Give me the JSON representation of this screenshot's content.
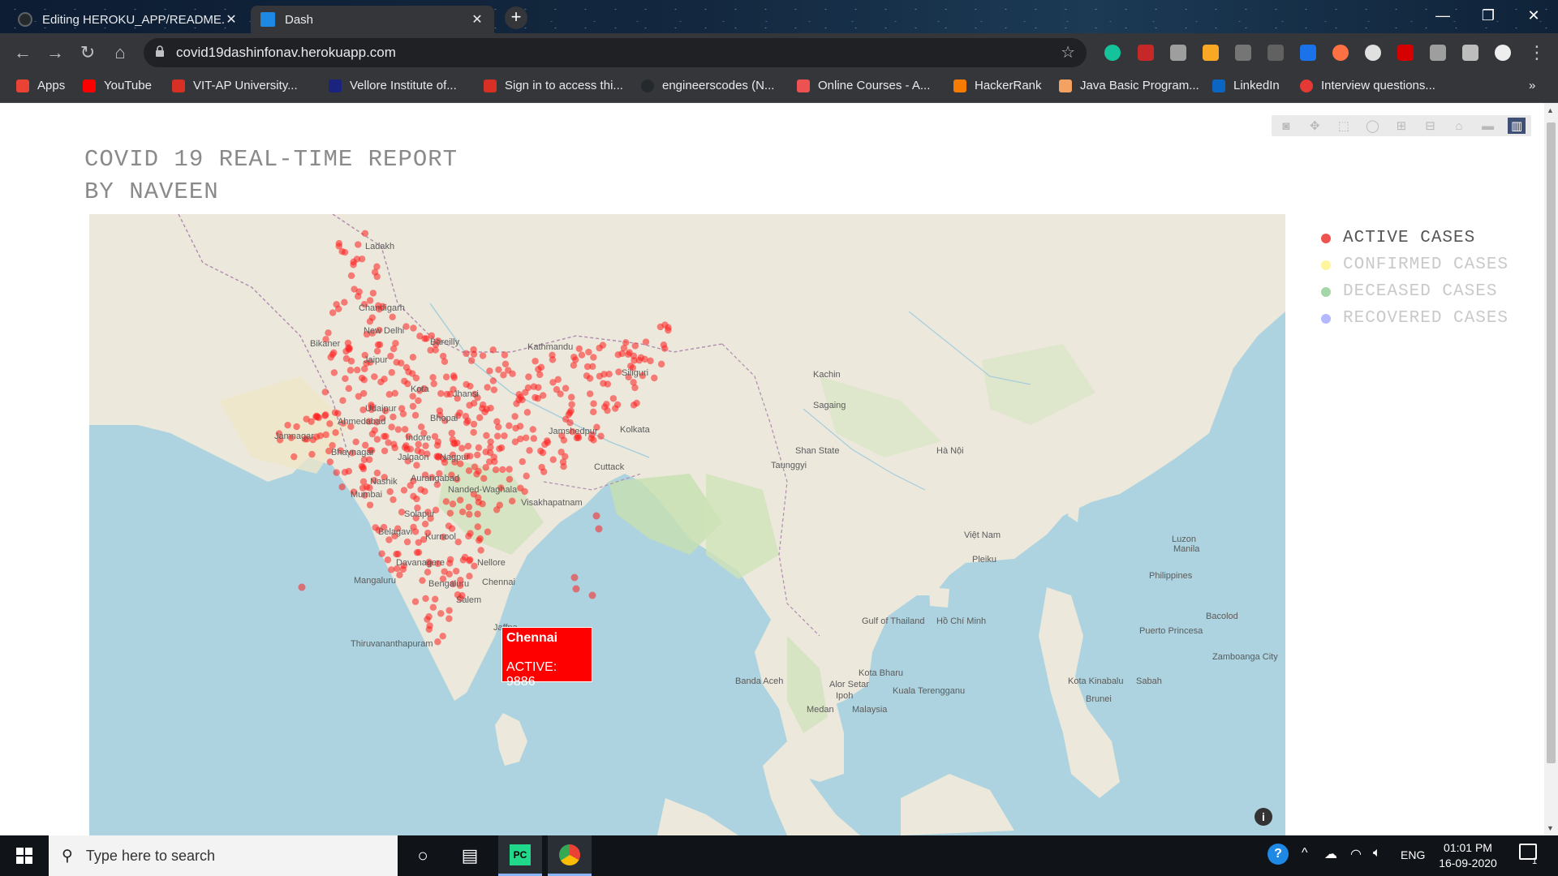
{
  "browser": {
    "tabs": [
      {
        "title": "Editing HEROKU_APP/README.m",
        "active": false
      },
      {
        "title": "Dash",
        "active": true
      }
    ],
    "url": "covid19dashinfonav.herokuapp.com",
    "bookmarks": [
      "Apps",
      "YouTube",
      "VIT-AP University...",
      "Vellore Institute of...",
      "Sign in to access thi...",
      "engineerscodes (N...",
      "Online Courses - A...",
      "HackerRank",
      "Java Basic Program...",
      "LinkedIn",
      "Interview questions..."
    ]
  },
  "page": {
    "title_line1": "COVID 19 REAL-TIME REPORT",
    "title_line2": "BY NAVEEN"
  },
  "legend": [
    {
      "label": "ACTIVE CASES",
      "color": "#ef5350"
    },
    {
      "label": "CONFIRMED CASES",
      "color": "#fff59d"
    },
    {
      "label": "DECEASED CASES",
      "color": "#a5d6a7"
    },
    {
      "label": "RECOVERED CASES",
      "color": "#b3b8ff"
    }
  ],
  "tooltip": {
    "city": "Chennai",
    "value": "ACTIVE: 9886"
  },
  "map_labels": [
    "Ladakh",
    "Chandigarh",
    "New Delhi",
    "Bareilly",
    "Kathmandu",
    "Jaipur",
    "Bikaner",
    "Kota",
    "Jhansi",
    "Bhopal",
    "Indore",
    "Ahmedabad",
    "Udaipur",
    "Jamnagar",
    "Bhavnagar",
    "Nagpur",
    "Jalgaon",
    "Nashik",
    "Mumbai",
    "Aurangabad",
    "Nanded-Waghala",
    "Solapur",
    "Belagavi",
    "Kurnool",
    "Davanagere",
    "Nellore",
    "Mangaluru",
    "Bengaluru",
    "Salem",
    "Thiruvananthapuram",
    "Jaffna",
    "Visakhapatnam",
    "Cuttack",
    "Kolkata",
    "Jamshedpur",
    "Siliguri",
    "Taunggyi",
    "Shan State",
    "Hà Nội",
    "Việt Nam",
    "Pleiku",
    "Hồ Chí Minh",
    "Philippines",
    "Luzon",
    "Manila",
    "Bacolod",
    "Puerto Princesa",
    "Zamboanga City",
    "Kota Bharu",
    "Alor Setar",
    "Ipoh",
    "Kuala Terengganu",
    "Medan",
    "Malaysia",
    "Banda Aceh",
    "Kota Kinabalu",
    "Sabah",
    "Brunei",
    "Gulf of Thailand",
    "Kachin",
    "Sagaing",
    "Chennai"
  ],
  "taskbar": {
    "search_placeholder": "Type here to search",
    "lang": "ENG",
    "time": "01:01 PM",
    "date": "16-09-2020",
    "notification_count": "1"
  },
  "icons": {
    "modebar": [
      "camera-icon",
      "pan-icon",
      "box-select-icon",
      "lasso-icon",
      "zoom-in-icon",
      "zoom-out-icon",
      "reset-icon",
      "toggle-hover-icon",
      "plotly-logo-icon"
    ]
  }
}
